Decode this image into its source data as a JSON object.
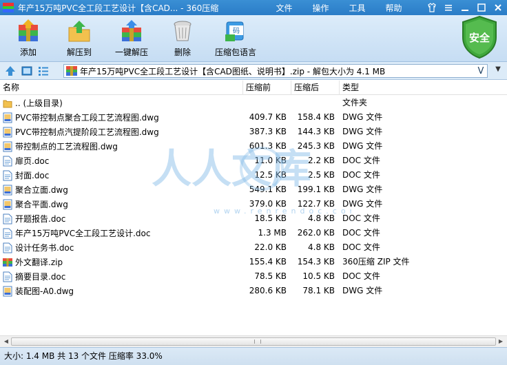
{
  "window": {
    "title": "年产15万吨PVC全工段工艺设计【含CAD... - 360压缩",
    "menu": [
      "文件",
      "操作",
      "工具",
      "帮助"
    ]
  },
  "toolbar": {
    "add": "添加",
    "extract_to": "解压到",
    "one_click_extract": "一键解压",
    "delete": "删除",
    "password": "压缩包语言",
    "security": "安全"
  },
  "address": {
    "path": "年产15万吨PVC全工段工艺设计【含CAD图纸、说明书】.zip - 解包大小为 4.1 MB",
    "v_mark": "V"
  },
  "columns": {
    "name": "名称",
    "size": "压缩前",
    "compressed": "压缩后",
    "type": "类型"
  },
  "files": [
    {
      "name": ".. (上级目录)",
      "size": "",
      "compressed": "",
      "type": "文件夹",
      "icon": "folder-icon"
    },
    {
      "name": "PVC带控制点聚合工段工艺流程图.dwg",
      "size": "409.7 KB",
      "compressed": "158.4 KB",
      "type": "DWG 文件",
      "icon": "dwg-icon"
    },
    {
      "name": "PVC带控制点汽提阶段工艺流程图.dwg",
      "size": "387.3 KB",
      "compressed": "144.3 KB",
      "type": "DWG 文件",
      "icon": "dwg-icon"
    },
    {
      "name": "带控制点的工艺流程图.dwg",
      "size": "601.3 KB",
      "compressed": "245.3 KB",
      "type": "DWG 文件",
      "icon": "dwg-icon"
    },
    {
      "name": "扉页.doc",
      "size": "11.0 KB",
      "compressed": "2.2 KB",
      "type": "DOC 文件",
      "icon": "doc-icon"
    },
    {
      "name": "封面.doc",
      "size": "12.5 KB",
      "compressed": "2.5 KB",
      "type": "DOC 文件",
      "icon": "doc-icon"
    },
    {
      "name": "聚合立面.dwg",
      "size": "549.1 KB",
      "compressed": "199.1 KB",
      "type": "DWG 文件",
      "icon": "dwg-icon"
    },
    {
      "name": "聚合平面.dwg",
      "size": "379.0 KB",
      "compressed": "122.7 KB",
      "type": "DWG 文件",
      "icon": "dwg-icon"
    },
    {
      "name": "开题报告.doc",
      "size": "18.5 KB",
      "compressed": "4.8 KB",
      "type": "DOC 文件",
      "icon": "doc-icon"
    },
    {
      "name": "年产15万吨PVC全工段工艺设计.doc",
      "size": "1.3 MB",
      "compressed": "262.0 KB",
      "type": "DOC 文件",
      "icon": "doc-icon"
    },
    {
      "name": "设计任务书.doc",
      "size": "22.0 KB",
      "compressed": "4.8 KB",
      "type": "DOC 文件",
      "icon": "doc-icon"
    },
    {
      "name": "外文翻译.zip",
      "size": "155.4 KB",
      "compressed": "154.3 KB",
      "type": "360压缩 ZIP 文件",
      "icon": "zip-icon"
    },
    {
      "name": "摘要目录.doc",
      "size": "78.5 KB",
      "compressed": "10.5 KB",
      "type": "DOC 文件",
      "icon": "doc-icon"
    },
    {
      "name": "装配图-A0.dwg",
      "size": "280.6 KB",
      "compressed": "78.1 KB",
      "type": "DWG 文件",
      "icon": "dwg-icon"
    }
  ],
  "watermark": {
    "text": "人人文库",
    "url": "www.renrendoc.com"
  },
  "status": {
    "text": "大小: 1.4 MB 共 13 个文件 压缩率 33.0%"
  }
}
